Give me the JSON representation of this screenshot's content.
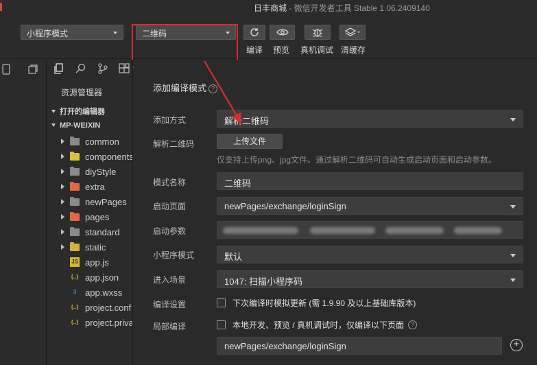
{
  "window": {
    "title_main": "日丰商城",
    "title_rest": " - 微信开发者工具 Stable 1.06.2409140"
  },
  "toolbar": {
    "mode_dropdown": "小程序模式",
    "compile_dropdown": "二维码",
    "buttons": [
      {
        "label": "编译",
        "icon": "refresh-icon"
      },
      {
        "label": "预览",
        "icon": "eye-icon"
      },
      {
        "label": "真机调试",
        "icon": "bug-icon"
      },
      {
        "label": "清缓存",
        "icon": "layers-icon"
      }
    ]
  },
  "explorer": {
    "title": "资源管理器",
    "open_editors": "打开的编辑器",
    "project": "MP-WEIXIN",
    "items": [
      {
        "name": "common",
        "type": "folder",
        "color": "#8a8a8a"
      },
      {
        "name": "components",
        "type": "folder",
        "color": "#d8c43a"
      },
      {
        "name": "diyStyle",
        "type": "folder",
        "color": "#8a8a8a"
      },
      {
        "name": "extra",
        "type": "folder",
        "color": "#e36a3f"
      },
      {
        "name": "newPages",
        "type": "folder",
        "color": "#8a8a8a"
      },
      {
        "name": "pages",
        "type": "folder",
        "color": "#e36a3f"
      },
      {
        "name": "standard",
        "type": "folder",
        "color": "#8a8a8a"
      },
      {
        "name": "static",
        "type": "folder",
        "color": "#d8b13a"
      },
      {
        "name": "app.js",
        "type": "js"
      },
      {
        "name": "app.json",
        "type": "json"
      },
      {
        "name": "app.wxss",
        "type": "css"
      },
      {
        "name": "project.conf",
        "type": "json"
      },
      {
        "name": "project.priva",
        "type": "json"
      }
    ]
  },
  "form": {
    "title": "添加编译模式",
    "add_method_label": "添加方式",
    "add_method_value": "解析二维码",
    "parse_qr_label": "解析二维码",
    "upload_button": "上传文件",
    "hint": "仅支持上传png、jpg文件。通过解析二维码可自动生成启动页面和启动参数。",
    "mode_name_label": "模式名称",
    "mode_name_value": "二维码",
    "start_page_label": "启动页面",
    "start_page_value": "newPages/exchange/loginSign",
    "start_params_label": "启动参数",
    "miniprogram_mode_label": "小程序模式",
    "miniprogram_mode_value": "默认",
    "scene_label": "进入场景",
    "scene_value": "1047: 扫描小程序码",
    "compile_settings_label": "编译设置",
    "compile_settings_check": "下次编译时模拟更新 (需 1.9.90 及以上基础库版本)",
    "partial_compile_label": "局部编译",
    "partial_compile_check": "本地开发、预览 / 真机调试时，仅编译以下页面",
    "partial_page_value": "newPages/exchange/loginSign"
  },
  "colors": {
    "highlight": "#e02a2a",
    "background": "#2a2a2a"
  }
}
